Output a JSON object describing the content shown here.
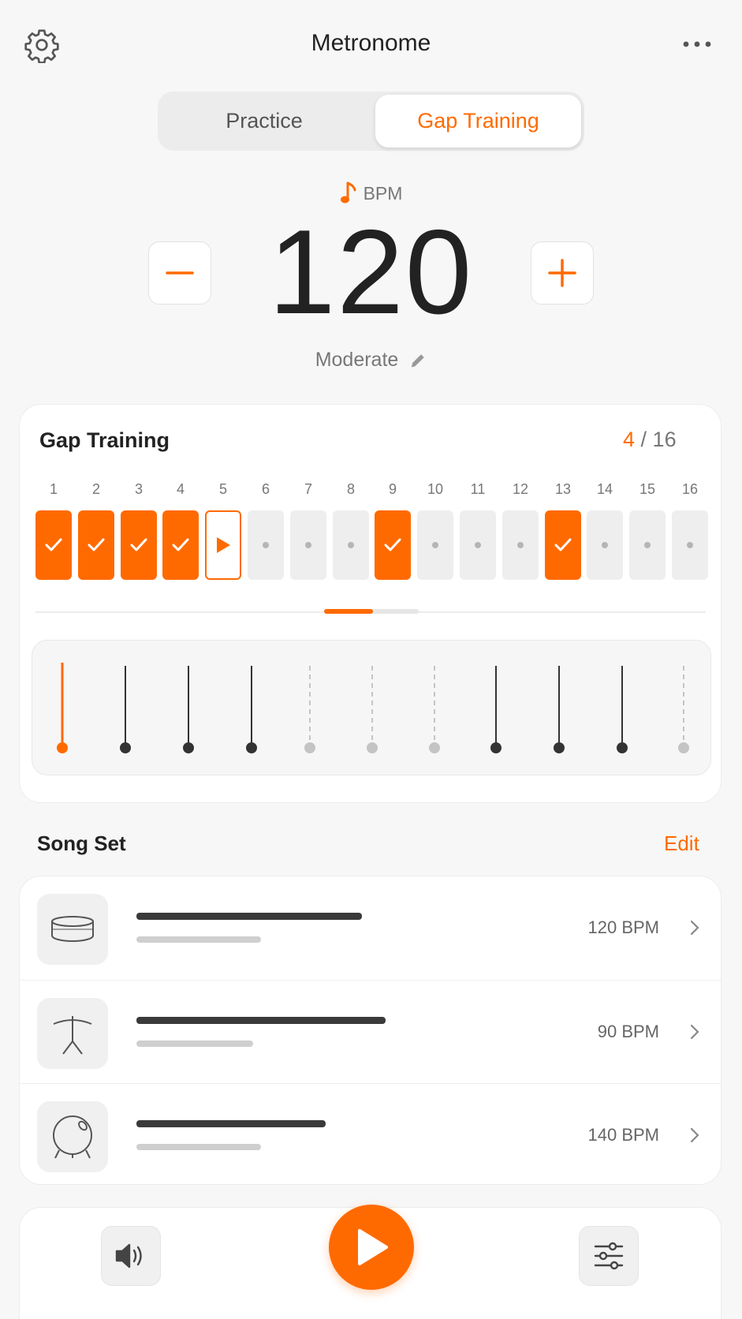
{
  "header": {
    "title": "Metronome",
    "settings_icon": "gear-icon",
    "more_icon": "more-horizontal-icon"
  },
  "tabs": [
    {
      "label": "Practice",
      "selected": false
    },
    {
      "label": "Gap Training",
      "selected": true
    }
  ],
  "bpm": {
    "label": "BPM",
    "value": "120",
    "tempo_name": "Moderate",
    "note_icon": "music-note-icon",
    "edit_icon": "pencil-icon"
  },
  "gap_training": {
    "title": "Gap Training",
    "current": "4",
    "separator": " / ",
    "total": "16",
    "beats": [
      {
        "n": "1",
        "state": "done"
      },
      {
        "n": "2",
        "state": "done"
      },
      {
        "n": "3",
        "state": "done"
      },
      {
        "n": "4",
        "state": "done"
      },
      {
        "n": "5",
        "state": "current"
      },
      {
        "n": "6",
        "state": "empty"
      },
      {
        "n": "7",
        "state": "empty"
      },
      {
        "n": "8",
        "state": "empty"
      },
      {
        "n": "9",
        "state": "done"
      },
      {
        "n": "10",
        "state": "empty"
      },
      {
        "n": "11",
        "state": "empty"
      },
      {
        "n": "12",
        "state": "empty"
      },
      {
        "n": "13",
        "state": "done"
      },
      {
        "n": "14",
        "state": "empty"
      },
      {
        "n": "15",
        "state": "empty"
      },
      {
        "n": "16",
        "state": "empty"
      }
    ],
    "ticks": [
      "accent",
      "on",
      "on",
      "on",
      "off",
      "off",
      "off",
      "on",
      "on",
      "on",
      "off"
    ]
  },
  "song_set": {
    "title": "Song Set",
    "edit_label": "Edit",
    "songs": [
      {
        "icon": "snare-drum-icon",
        "bpm": "120 BPM"
      },
      {
        "icon": "cymbal-icon",
        "bpm": "90 BPM"
      },
      {
        "icon": "bass-drum-icon",
        "bpm": "140 BPM"
      }
    ]
  },
  "controls": {
    "volume_icon": "speaker-icon",
    "play_icon": "play-icon",
    "mixer_icon": "sliders-icon"
  },
  "colors": {
    "accent": "#ff6a00",
    "background": "#f7f7f7"
  }
}
